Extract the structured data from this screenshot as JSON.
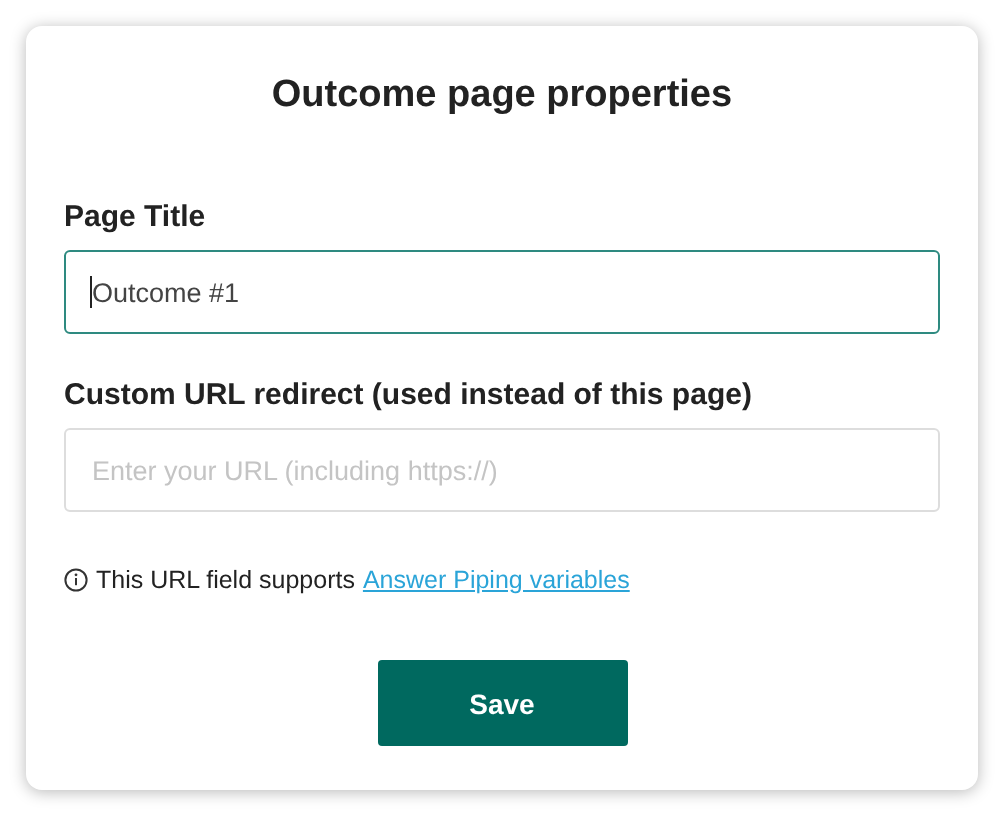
{
  "dialog": {
    "title": "Outcome page properties"
  },
  "fields": [
    {
      "label": "Page Title",
      "value": "Outcome #1",
      "focused": true
    },
    {
      "label": "Custom URL redirect (used instead of this page)",
      "placeholder": "Enter your URL (including https://)",
      "focused": false
    }
  ],
  "note": {
    "text": "This URL field supports",
    "link": "Answer Piping variables"
  },
  "save_button": "Save"
}
